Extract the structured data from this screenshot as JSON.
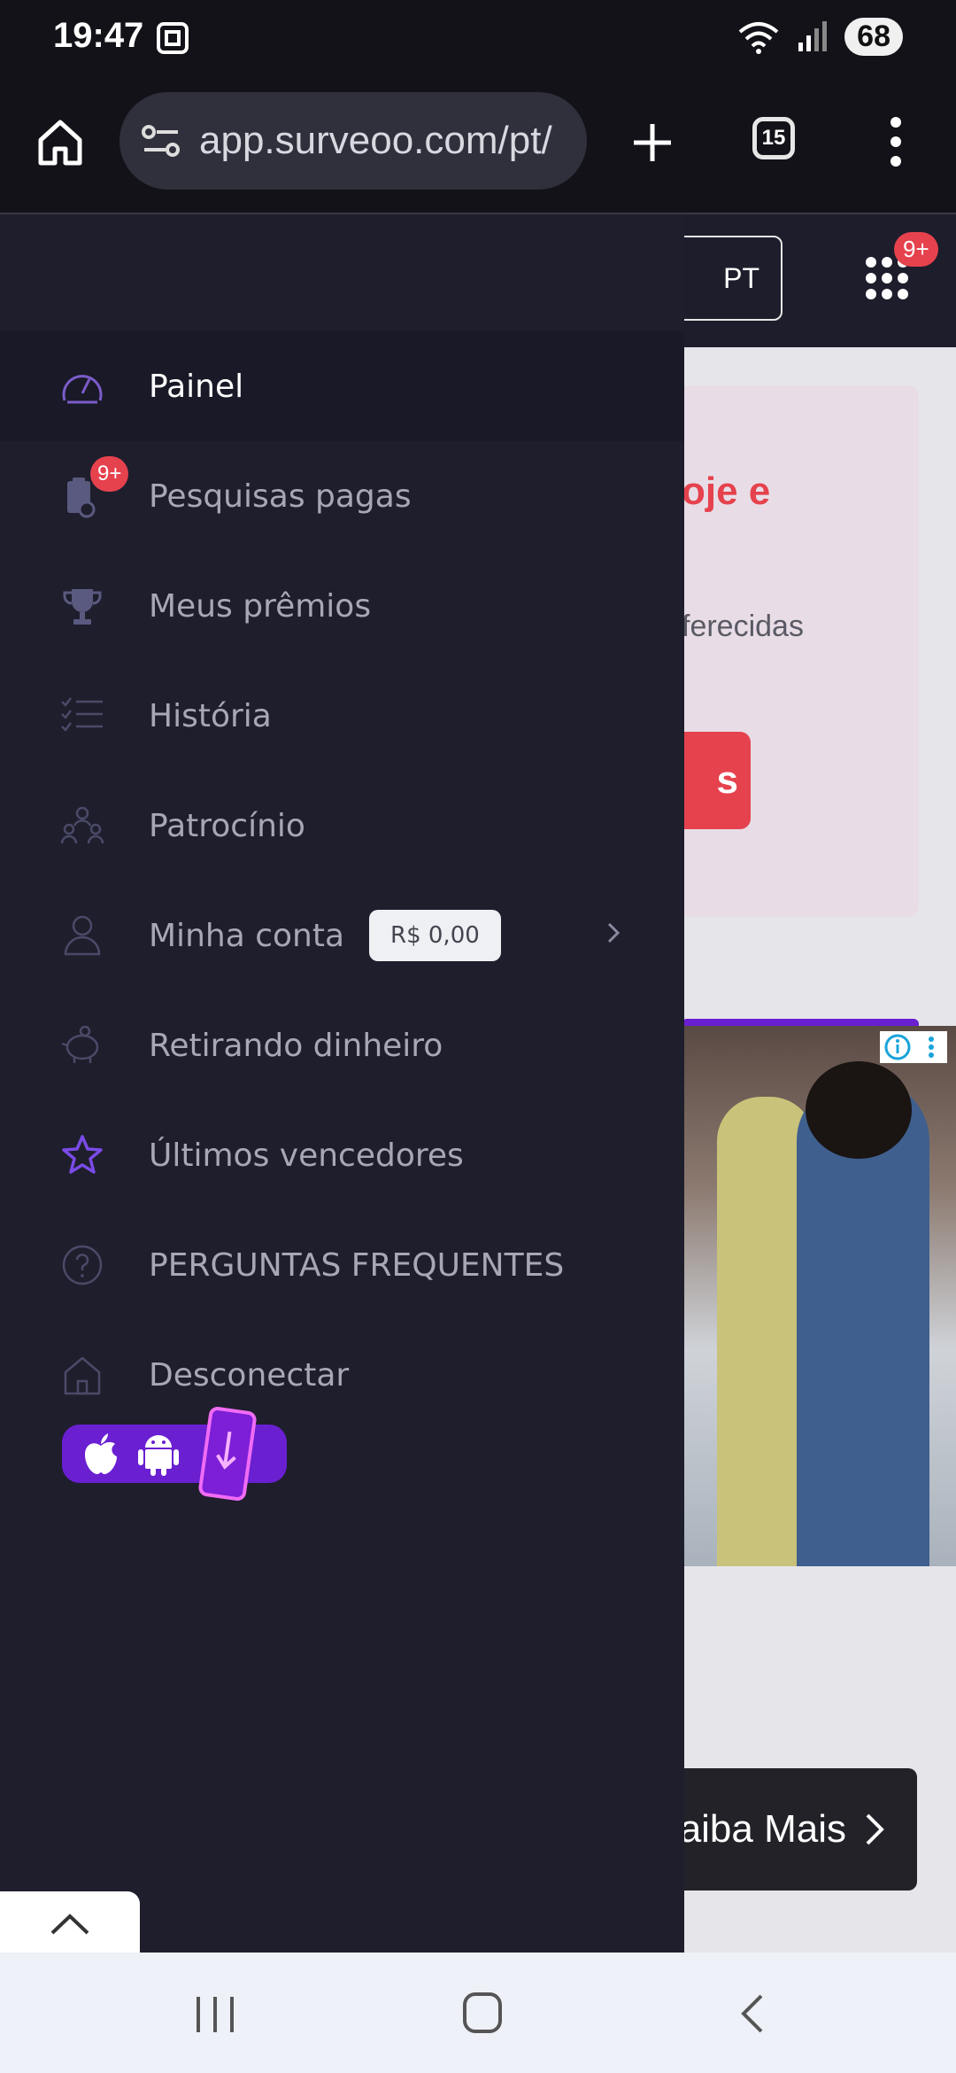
{
  "status_bar": {
    "time": "19:47",
    "network": "5",
    "battery": "68"
  },
  "browser": {
    "url": "app.surveoo.com/pt/",
    "tab_count": "15"
  },
  "site_header": {
    "language": "PT",
    "apps_badge": "9+"
  },
  "background_page": {
    "promo_title_fragment": "oje e",
    "promo_subtitle_fragment": "ferecidas",
    "promo_button_fragment": "s",
    "ad_button_label": "aiba Mais"
  },
  "menu": {
    "items": [
      {
        "label": "Painel",
        "icon": "speedometer-icon",
        "active": true
      },
      {
        "label": "Pesquisas pagas",
        "icon": "clipboard-money-icon",
        "badge": "9+"
      },
      {
        "label": "Meus prêmios",
        "icon": "trophy-icon"
      },
      {
        "label": "História",
        "icon": "checklist-icon"
      },
      {
        "label": "Patrocínio",
        "icon": "referral-icon"
      },
      {
        "label": "Minha conta",
        "icon": "user-icon",
        "balance": "R$ 0,00"
      },
      {
        "label": "Retirando dinheiro",
        "icon": "piggy-bank-icon"
      },
      {
        "label": "Últimos vencedores",
        "icon": "star-icon"
      },
      {
        "label": "PERGUNTAS FREQUENTES",
        "icon": "question-icon"
      },
      {
        "label": "Desconectar",
        "icon": "home-icon"
      }
    ]
  },
  "colors": {
    "drawer_bg": "#1e1e2d",
    "accent_red": "#e5424d",
    "accent_purple": "#6a1fd1",
    "star_purple": "#7a4be6"
  }
}
